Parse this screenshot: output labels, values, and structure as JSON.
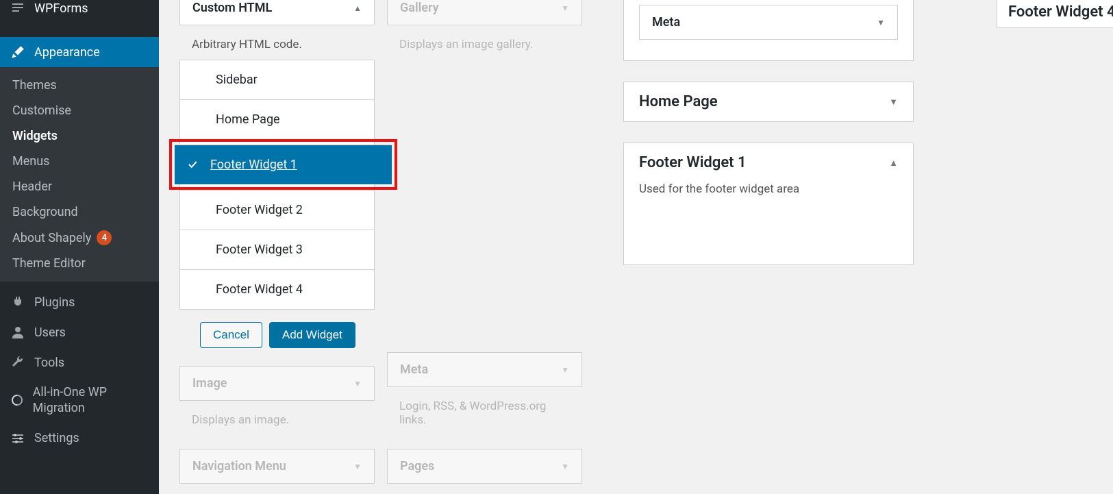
{
  "sidebar": {
    "wpforms": "WPForms",
    "appearance": "Appearance",
    "submenu": {
      "themes": "Themes",
      "customise": "Customise",
      "widgets": "Widgets",
      "menus": "Menus",
      "header": "Header",
      "background": "Background",
      "about_shapely": "About Shapely",
      "about_shapely_count": "4",
      "theme_editor": "Theme Editor"
    },
    "plugins": "Plugins",
    "users": "Users",
    "tools": "Tools",
    "migration": "All-in-One WP Migration",
    "settings": "Settings"
  },
  "widgets": {
    "custom_html": {
      "title": "Custom HTML",
      "desc": "Arbitrary HTML code.",
      "areas": [
        "Sidebar",
        "Home Page",
        "Footer Widget 1",
        "Footer Widget 2",
        "Footer Widget 3",
        "Footer Widget 4"
      ],
      "cancel": "Cancel",
      "add": "Add Widget"
    },
    "gallery": {
      "title": "Gallery",
      "desc": "Displays an image gallery."
    },
    "image": {
      "title": "Image",
      "desc": "Displays an image."
    },
    "meta": {
      "title": "Meta",
      "desc": "Login, RSS, & WordPress.org links."
    },
    "nav": {
      "title": "Navigation Menu"
    },
    "pages": {
      "title": "Pages"
    }
  },
  "areas_right": {
    "meta_item": "Meta",
    "home_page": "Home Page",
    "footer1": {
      "title": "Footer Widget 1",
      "desc": "Used for the footer widget area"
    },
    "footer4": "Footer Widget 4"
  }
}
